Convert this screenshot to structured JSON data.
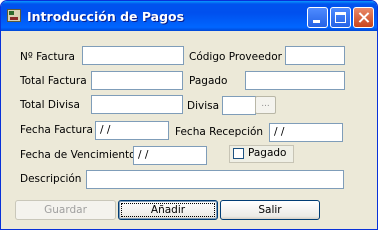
{
  "window": {
    "title": "Introducción de Pagos"
  },
  "form": {
    "n_factura": {
      "label": "Nº Factura",
      "value": ""
    },
    "codigo_proveedor": {
      "label": "Código Proveedor",
      "value": ""
    },
    "total_factura": {
      "label": "Total Factura",
      "value": ""
    },
    "pagado_importe": {
      "label": "Pagado",
      "value": ""
    },
    "total_divisa": {
      "label": "Total Divisa",
      "value": ""
    },
    "divisa": {
      "label": "Divisa",
      "value": "",
      "browse_label": "..."
    },
    "fecha_factura": {
      "label": "Fecha Factura",
      "value": " / /"
    },
    "fecha_recepcion": {
      "label": "Fecha Recepción",
      "value": " / /"
    },
    "fecha_vencimiento": {
      "label": "Fecha de Vencimiento",
      "value": " / /"
    },
    "pagado_check": {
      "label": "Pagado",
      "checked": false
    },
    "descripcion": {
      "label": "Descripción",
      "value": ""
    }
  },
  "buttons": {
    "guardar": "Guardar",
    "anadir": "Añadir",
    "salir": "Salir"
  }
}
